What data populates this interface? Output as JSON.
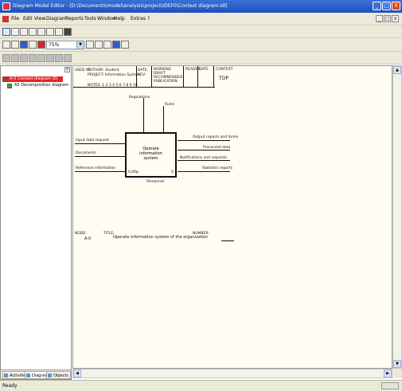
{
  "window": {
    "title": "Diagram Model Editor - [D:\\Documents\\model\\analysis\\project\\IDEF0\\Context diagram.idl]",
    "buttons": [
      "_",
      "□",
      "X"
    ]
  },
  "menu": {
    "items": [
      "File",
      "Edit",
      "View",
      "Diagram",
      "Reports",
      "Tools",
      "Window",
      "Help",
      "Extras",
      "?"
    ],
    "mdi_buttons": [
      "_",
      "□",
      "x"
    ]
  },
  "toolbar_2": {
    "zoom_combo": "75%"
  },
  "tree": {
    "items": [
      "A-0 Context diagram (0)",
      "A0 Decomposition diagram"
    ]
  },
  "tabs": [
    "Activities",
    "Diagrams",
    "Objects"
  ],
  "diagram": {
    "header": {
      "used_at": "USED AT:",
      "author": "AUTHOR: Student",
      "project": "PROJECT: Information System",
      "date": "DATE:",
      "rev": "REV:",
      "working": "WORKING",
      "draft": "DRAFT",
      "recommended": "RECOMMENDED",
      "publication": "PUBLICATION",
      "reader": "READER",
      "date2": "DATE",
      "context": "CONTEXT:",
      "top": "TOP",
      "notes": "NOTES: 1 2 3 4 5 6 7 8 9 10"
    },
    "box": {
      "line1": "Operate",
      "line2": "information",
      "line3": "system",
      "number": "0",
      "cost": "0,00р."
    },
    "inputs": [
      "Input data request",
      "Documents",
      "Reference information"
    ],
    "controls": [
      "Regulations",
      "Rules"
    ],
    "outputs": [
      "Output reports and forms",
      "Processed data",
      "Notifications and requests",
      "Statistics reports"
    ],
    "mechanism": "Personnel",
    "footer": {
      "node_label": "NODE:",
      "node": "A-0",
      "title_label": "TITLE:",
      "title": "Operate information system of the organization",
      "number_label": "NUMBER:"
    }
  },
  "status": {
    "text": "Ready"
  },
  "colors": {
    "titlebar": "#2b5ec9",
    "canvas": "#fffcf2",
    "tree_selected": "#e22525"
  }
}
